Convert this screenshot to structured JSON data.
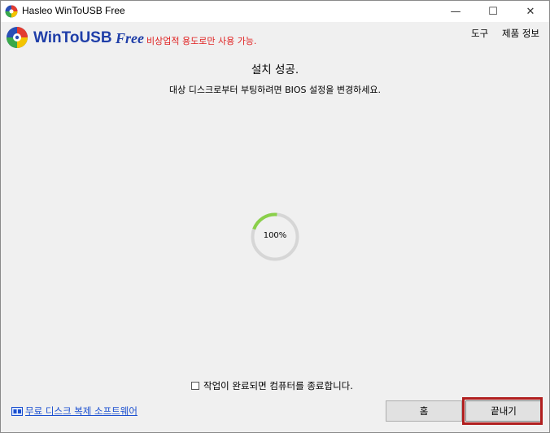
{
  "window": {
    "title": "Hasleo WinToUSB Free",
    "controls": {
      "minimize": "—",
      "maximize": "☐",
      "close": "✕"
    }
  },
  "brand": {
    "name": "WinToUSB",
    "edition": "Free",
    "note": "비상업적 용도로만 사용 가능."
  },
  "menu": {
    "tools": "도구",
    "about": "제품 정보"
  },
  "status": {
    "title": "설치 성공.",
    "message": "대상 디스크로부터 부팅하려면 BIOS 설정을 변경하세요."
  },
  "progress": {
    "value": 100,
    "label": "100%"
  },
  "shutdown_option": {
    "label": "작업이 완료되면 컴퓨터를 종료합니다.",
    "checked": false
  },
  "footer": {
    "link": "무료 디스크 복제 소프트웨어"
  },
  "buttons": {
    "home": "홈",
    "finish": "끝내기"
  },
  "colors": {
    "brand": "#1f3ea8",
    "note": "#e02020",
    "progress": "#8ad04a",
    "highlight": "#b01e1e",
    "link": "#1a4fd0"
  }
}
